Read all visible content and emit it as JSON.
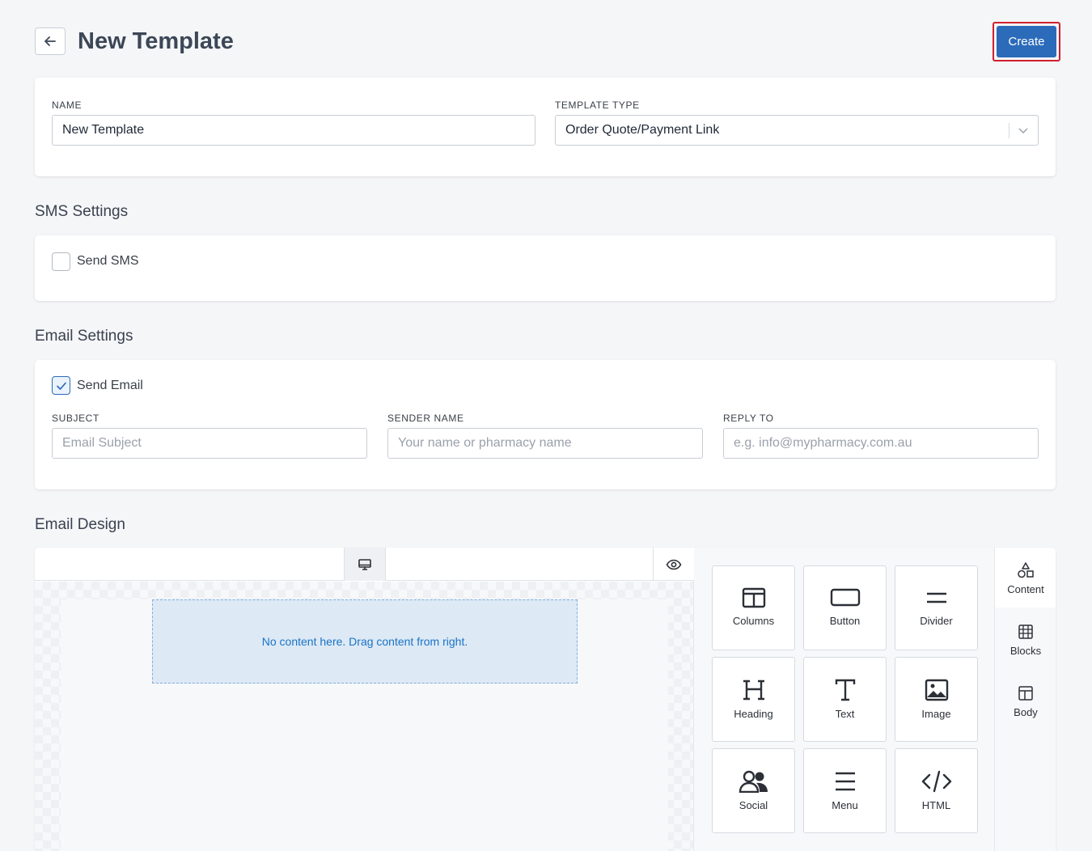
{
  "header": {
    "title": "New Template",
    "create_label": "Create"
  },
  "template_form": {
    "name_label": "NAME",
    "name_value": "New Template",
    "type_label": "TEMPLATE TYPE",
    "type_value": "Order Quote/Payment Link"
  },
  "sms_settings": {
    "title": "SMS Settings",
    "send_sms_label": "Send SMS",
    "send_sms_checked": false
  },
  "email_settings": {
    "title": "Email Settings",
    "send_email_label": "Send Email",
    "send_email_checked": true,
    "subject_label": "SUBJECT",
    "subject_placeholder": "Email Subject",
    "sender_label": "SENDER NAME",
    "sender_placeholder": "Your name or pharmacy name",
    "reply_label": "REPLY TO",
    "reply_placeholder": "e.g. info@mypharmacy.com.au"
  },
  "email_design": {
    "title": "Email Design",
    "empty_message": "No content here. Drag content from right.",
    "tools": [
      {
        "label": "Columns",
        "icon": "columns-icon"
      },
      {
        "label": "Button",
        "icon": "button-icon"
      },
      {
        "label": "Divider",
        "icon": "divider-icon"
      },
      {
        "label": "Heading",
        "icon": "heading-icon"
      },
      {
        "label": "Text",
        "icon": "text-icon"
      },
      {
        "label": "Image",
        "icon": "image-icon"
      },
      {
        "label": "Social",
        "icon": "social-icon"
      },
      {
        "label": "Menu",
        "icon": "menu-icon"
      },
      {
        "label": "HTML",
        "icon": "html-icon"
      }
    ],
    "tabs": [
      {
        "label": "Content",
        "icon": "shapes-icon",
        "active": true
      },
      {
        "label": "Blocks",
        "icon": "blocks-icon",
        "active": false
      },
      {
        "label": "Body",
        "icon": "layout-icon",
        "active": false
      }
    ]
  },
  "colors": {
    "primary": "#2c6bba",
    "highlight": "#d0202f",
    "drop_zone": "#dde9f4",
    "drop_text": "#1a73c8"
  }
}
